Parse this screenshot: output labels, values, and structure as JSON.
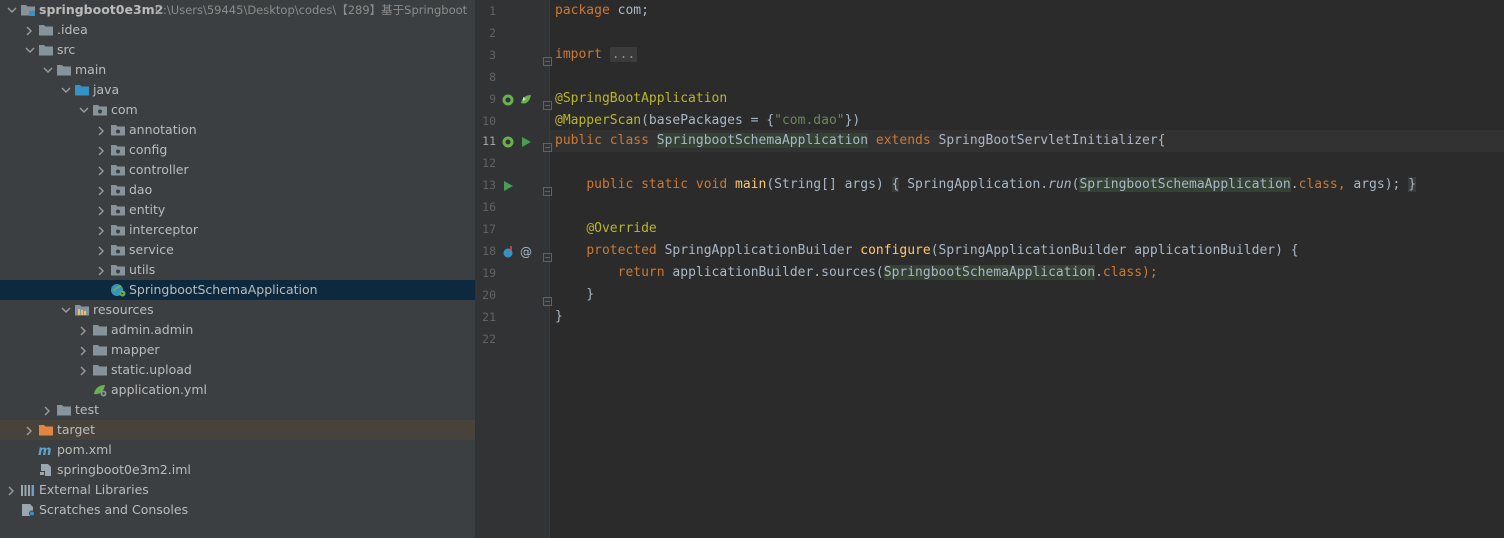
{
  "project_tree": [
    {
      "id": "root",
      "label": "springboot0e3m2",
      "path": "C:\\Users\\59445\\Desktop\\codes\\【289】基于Springboot",
      "icon": "module-folder-icon",
      "depth": 0,
      "expanded": true
    },
    {
      "id": "idea",
      "label": ".idea",
      "icon": "folder-icon",
      "depth": 1,
      "expanded": false
    },
    {
      "id": "src",
      "label": "src",
      "icon": "folder-icon",
      "depth": 1,
      "expanded": true
    },
    {
      "id": "main",
      "label": "main",
      "icon": "folder-icon",
      "depth": 2,
      "expanded": true
    },
    {
      "id": "java",
      "label": "java",
      "icon": "source-folder-icon",
      "depth": 3,
      "expanded": true
    },
    {
      "id": "com",
      "label": "com",
      "icon": "package-icon",
      "depth": 4,
      "expanded": true
    },
    {
      "id": "annotation",
      "label": "annotation",
      "icon": "package-icon",
      "depth": 5,
      "expanded": false
    },
    {
      "id": "config",
      "label": "config",
      "icon": "package-icon",
      "depth": 5,
      "expanded": false
    },
    {
      "id": "controller",
      "label": "controller",
      "icon": "package-icon",
      "depth": 5,
      "expanded": false
    },
    {
      "id": "dao",
      "label": "dao",
      "icon": "package-icon",
      "depth": 5,
      "expanded": false
    },
    {
      "id": "entity",
      "label": "entity",
      "icon": "package-icon",
      "depth": 5,
      "expanded": false
    },
    {
      "id": "interceptor",
      "label": "interceptor",
      "icon": "package-icon",
      "depth": 5,
      "expanded": false
    },
    {
      "id": "service",
      "label": "service",
      "icon": "package-icon",
      "depth": 5,
      "expanded": false
    },
    {
      "id": "utils",
      "label": "utils",
      "icon": "package-icon",
      "depth": 5,
      "expanded": false
    },
    {
      "id": "app-class",
      "label": "SpringbootSchemaApplication",
      "icon": "spring-boot-class-icon",
      "depth": 5,
      "selected": true
    },
    {
      "id": "resources",
      "label": "resources",
      "icon": "resources-folder-icon",
      "depth": 3,
      "expanded": true
    },
    {
      "id": "admin-admin",
      "label": "admin.admin",
      "icon": "folder-icon",
      "depth": 4,
      "expanded": false
    },
    {
      "id": "mapper",
      "label": "mapper",
      "icon": "folder-icon",
      "depth": 4,
      "expanded": false
    },
    {
      "id": "static-upload",
      "label": "static.upload",
      "icon": "folder-icon",
      "depth": 4,
      "expanded": false
    },
    {
      "id": "application-yml",
      "label": "application.yml",
      "icon": "spring-config-file-icon",
      "depth": 4
    },
    {
      "id": "test",
      "label": "test",
      "icon": "folder-icon",
      "depth": 2,
      "expanded": false
    },
    {
      "id": "target",
      "label": "target",
      "icon": "excluded-folder-icon",
      "depth": 1,
      "expanded": false,
      "highlighted": true
    },
    {
      "id": "pom",
      "label": "pom.xml",
      "icon": "maven-icon",
      "depth": 1
    },
    {
      "id": "iml",
      "label": "springboot0e3m2.iml",
      "icon": "module-file-icon",
      "depth": 1
    },
    {
      "id": "ext-libs",
      "label": "External Libraries",
      "icon": "libraries-icon",
      "depth": 0,
      "expanded": false
    },
    {
      "id": "scratches",
      "label": "Scratches and Consoles",
      "icon": "scratches-icon",
      "depth": 0
    }
  ],
  "editor": {
    "current_line": 11,
    "lines": [
      {
        "n": 1,
        "tokens": [
          {
            "t": "package ",
            "c": "kw"
          },
          {
            "t": "com;",
            "c": "pl"
          }
        ]
      },
      {
        "n": 2,
        "tokens": []
      },
      {
        "n": 3,
        "tokens": [
          {
            "t": "import ",
            "c": "kw"
          },
          {
            "t": "...",
            "c": "fld"
          }
        ]
      },
      {
        "n": 8,
        "tokens": []
      },
      {
        "n": 9,
        "tokens": [
          {
            "t": "@SpringBootApplication",
            "c": "ann"
          }
        ]
      },
      {
        "n": 10,
        "tokens": [
          {
            "t": "@MapperScan",
            "c": "ann"
          },
          {
            "t": "(basePackages = {",
            "c": "pl"
          },
          {
            "t": "\"com.dao\"",
            "c": "str"
          },
          {
            "t": "})",
            "c": "pl"
          }
        ]
      },
      {
        "n": 11,
        "tokens": [
          {
            "t": "public class ",
            "c": "kw"
          },
          {
            "t": "SpringbootSchemaApplication",
            "c": "hl"
          },
          {
            "t": " ",
            "c": "pl"
          },
          {
            "t": "extends ",
            "c": "kw"
          },
          {
            "t": "SpringBootServletInitializer{",
            "c": "pl"
          }
        ]
      },
      {
        "n": 12,
        "tokens": []
      },
      {
        "n": 13,
        "tokens": [
          {
            "t": "    ",
            "c": "pl"
          },
          {
            "t": "public static void ",
            "c": "kw"
          },
          {
            "t": "main",
            "c": "fn"
          },
          {
            "t": "(String[] args) ",
            "c": "pl"
          },
          {
            "t": "{",
            "c": "brf"
          },
          {
            "t": " SpringApplication.",
            "c": "pl"
          },
          {
            "t": "run",
            "c": "it"
          },
          {
            "t": "(",
            "c": "pl"
          },
          {
            "t": "SpringbootSchemaApplication",
            "c": "hl"
          },
          {
            "t": ".",
            "c": "pl"
          },
          {
            "t": "class, ",
            "c": "kw"
          },
          {
            "t": "args); ",
            "c": "pl"
          },
          {
            "t": "}",
            "c": "brf"
          }
        ]
      },
      {
        "n": 16,
        "tokens": []
      },
      {
        "n": 17,
        "tokens": [
          {
            "t": "    ",
            "c": "pl"
          },
          {
            "t": "@Override",
            "c": "ann"
          }
        ]
      },
      {
        "n": 18,
        "tokens": [
          {
            "t": "    ",
            "c": "pl"
          },
          {
            "t": "protected ",
            "c": "kw"
          },
          {
            "t": "SpringApplicationBuilder ",
            "c": "pl"
          },
          {
            "t": "configure",
            "c": "fn"
          },
          {
            "t": "(SpringApplicationBuilder applicationBuilder) {",
            "c": "pl"
          }
        ]
      },
      {
        "n": 19,
        "tokens": [
          {
            "t": "        ",
            "c": "pl"
          },
          {
            "t": "return ",
            "c": "kw"
          },
          {
            "t": "applicationBuilder.sources(",
            "c": "pl"
          },
          {
            "t": "SpringbootSchemaApplication",
            "c": "hl"
          },
          {
            "t": ".",
            "c": "pl"
          },
          {
            "t": "class",
            "c": "kw"
          },
          {
            "t": ");",
            "c": "kw"
          }
        ]
      },
      {
        "n": 20,
        "tokens": [
          {
            "t": "    }",
            "c": "pl"
          }
        ]
      },
      {
        "n": 21,
        "tokens": [
          {
            "t": "}",
            "c": "pl"
          }
        ]
      },
      {
        "n": 22,
        "tokens": []
      }
    ]
  },
  "gutter_icons": [
    {
      "line": 9,
      "icons": [
        "spring-bean-icon",
        "spring-boot-run-icon"
      ]
    },
    {
      "line": 11,
      "icons": [
        "spring-bean-icon",
        "run-icon"
      ]
    },
    {
      "line": 13,
      "icons": [
        "run-icon"
      ]
    },
    {
      "line": 18,
      "icons": [
        "override-method-icon",
        "at-annotation-icon"
      ]
    }
  ]
}
